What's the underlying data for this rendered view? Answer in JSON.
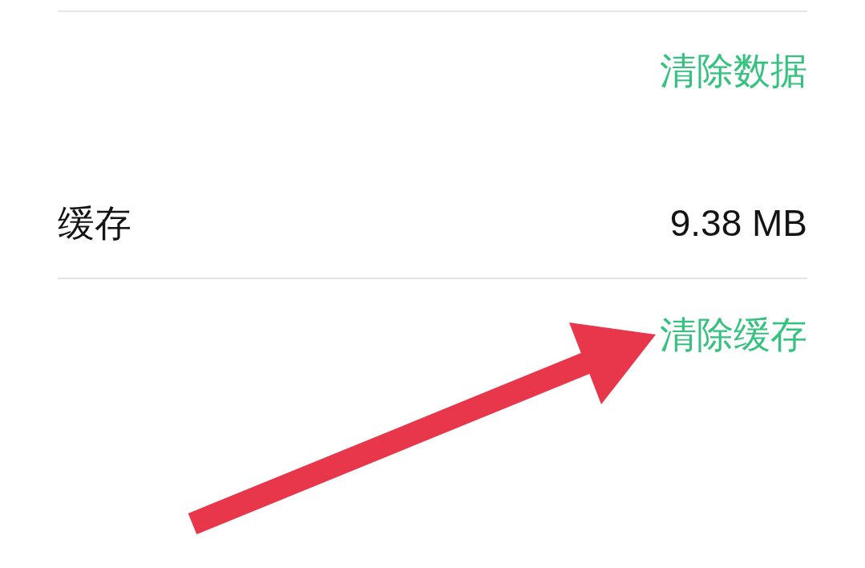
{
  "rows": [
    {
      "kind": "action",
      "label": "清除数据"
    },
    {
      "kind": "info",
      "label": "缓存",
      "value": "9.38 MB"
    },
    {
      "kind": "action",
      "label": "清除缓存"
    }
  ],
  "annotation": {
    "kind": "arrow"
  }
}
